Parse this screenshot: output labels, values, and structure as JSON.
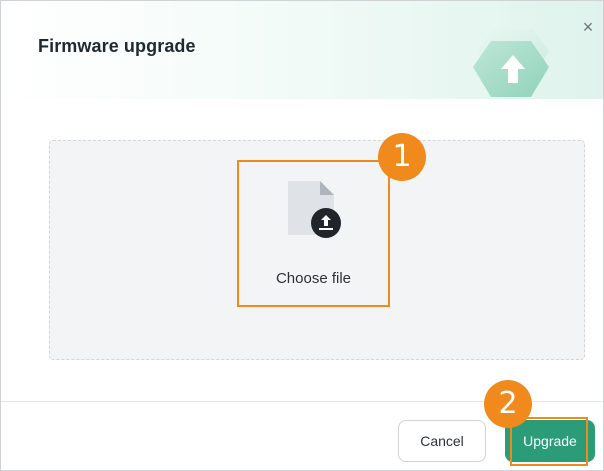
{
  "dialog": {
    "title": "Firmware upgrade",
    "close_glyph": "×"
  },
  "upload": {
    "choose_label": "Choose file",
    "icons": [
      "file-icon",
      "upload-icon"
    ]
  },
  "callouts": {
    "step1": "1",
    "step2": "2"
  },
  "footer": {
    "cancel_label": "Cancel",
    "upgrade_label": "Upgrade"
  },
  "colors": {
    "accent": "#2a9d78",
    "highlight": "#f08a1c",
    "dropzone_bg": "#f3f4f5"
  }
}
